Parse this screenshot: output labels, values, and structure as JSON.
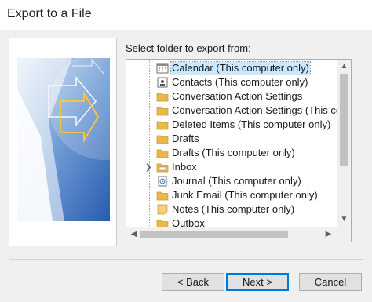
{
  "window": {
    "title": "Export to a File"
  },
  "prompt": "Select folder to export from:",
  "folders": [
    {
      "label": "Calendar (This computer only)",
      "icon": "calendar-icon",
      "selected": true
    },
    {
      "label": "Contacts (This computer only)",
      "icon": "contacts-icon"
    },
    {
      "label": "Conversation Action Settings",
      "icon": "folder-icon"
    },
    {
      "label": "Conversation Action Settings (This com",
      "icon": "folder-icon"
    },
    {
      "label": "Deleted Items (This computer only)",
      "icon": "folder-icon"
    },
    {
      "label": "Drafts",
      "icon": "folder-icon"
    },
    {
      "label": "Drafts (This computer only)",
      "icon": "folder-icon"
    },
    {
      "label": "Inbox",
      "icon": "inbox-folder-icon",
      "expandable": true
    },
    {
      "label": "Journal (This computer only)",
      "icon": "journal-icon"
    },
    {
      "label": "Junk Email (This computer only)",
      "icon": "folder-icon"
    },
    {
      "label": "Notes (This computer only)",
      "icon": "notes-icon"
    },
    {
      "label": "Outbox",
      "icon": "folder-icon"
    }
  ],
  "buttons": {
    "back": "< Back",
    "next": "Next >",
    "cancel": "Cancel"
  },
  "colors": {
    "accent": "#0078d7",
    "folder": "#e8b84a",
    "selection": "#cce8ff"
  }
}
